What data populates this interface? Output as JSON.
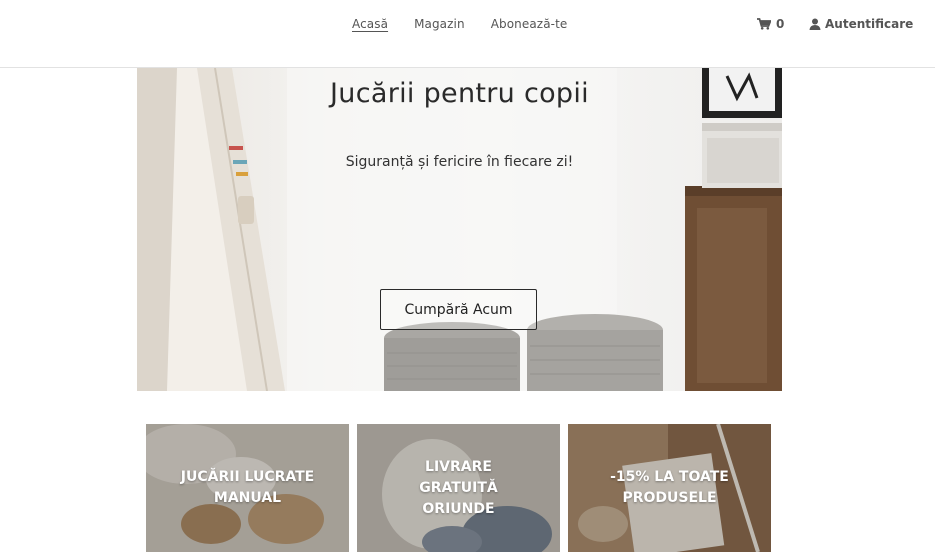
{
  "nav": {
    "items": [
      {
        "label": "Acasă",
        "active": true
      },
      {
        "label": "Magazin",
        "active": false
      },
      {
        "label": "Abonează-te",
        "active": false
      }
    ]
  },
  "cart": {
    "icon": "cart-icon",
    "count": "0"
  },
  "account": {
    "icon": "user-icon",
    "label": "Autentificare"
  },
  "hero": {
    "title": "Jucării pentru copii",
    "subtitle": "Siguranță și fericire în fiecare zi!",
    "button_label": "Cumpără Acum"
  },
  "tiles": [
    {
      "label": "JUCĂRII LUCRATE MANUAL"
    },
    {
      "label": "LIVRARE GRATUITĂ ORIUNDE"
    },
    {
      "label": "-15% LA TOATE PRODUSELE"
    }
  ]
}
